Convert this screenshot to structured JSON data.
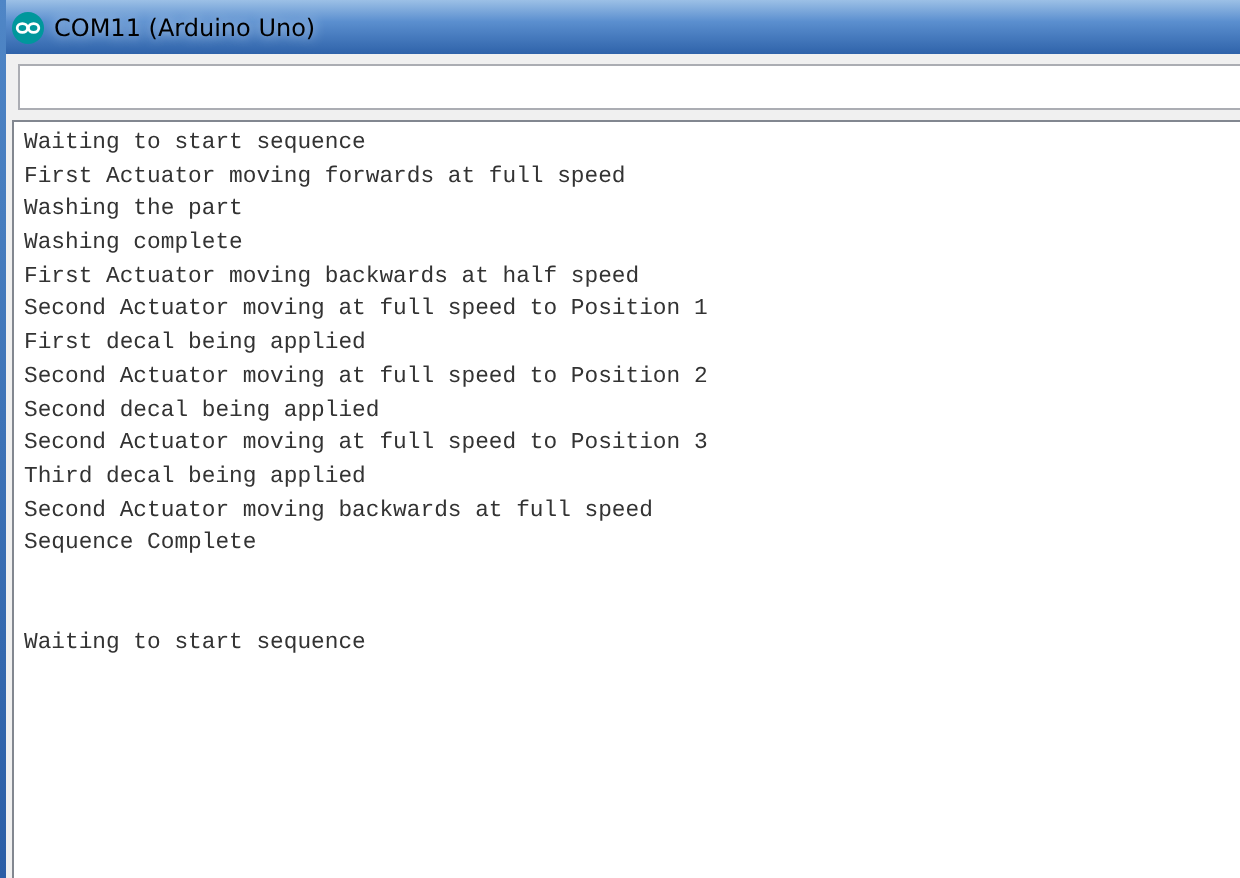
{
  "window": {
    "title": "COM11 (Arduino Uno)"
  },
  "output": {
    "blocks": [
      [
        "Waiting to start sequence",
        "First Actuator moving forwards at full speed",
        "Washing the part",
        "Washing complete",
        "First Actuator moving backwards at half speed",
        "Second Actuator moving at full speed to Position 1",
        "First decal being applied",
        "Second Actuator moving at full speed to Position 2",
        "Second decal being applied",
        "Second Actuator moving at full speed to Position 3",
        "Third decal being applied",
        "Second Actuator moving backwards at full speed",
        "Sequence Complete"
      ],
      [
        "Waiting to start sequence"
      ]
    ]
  }
}
